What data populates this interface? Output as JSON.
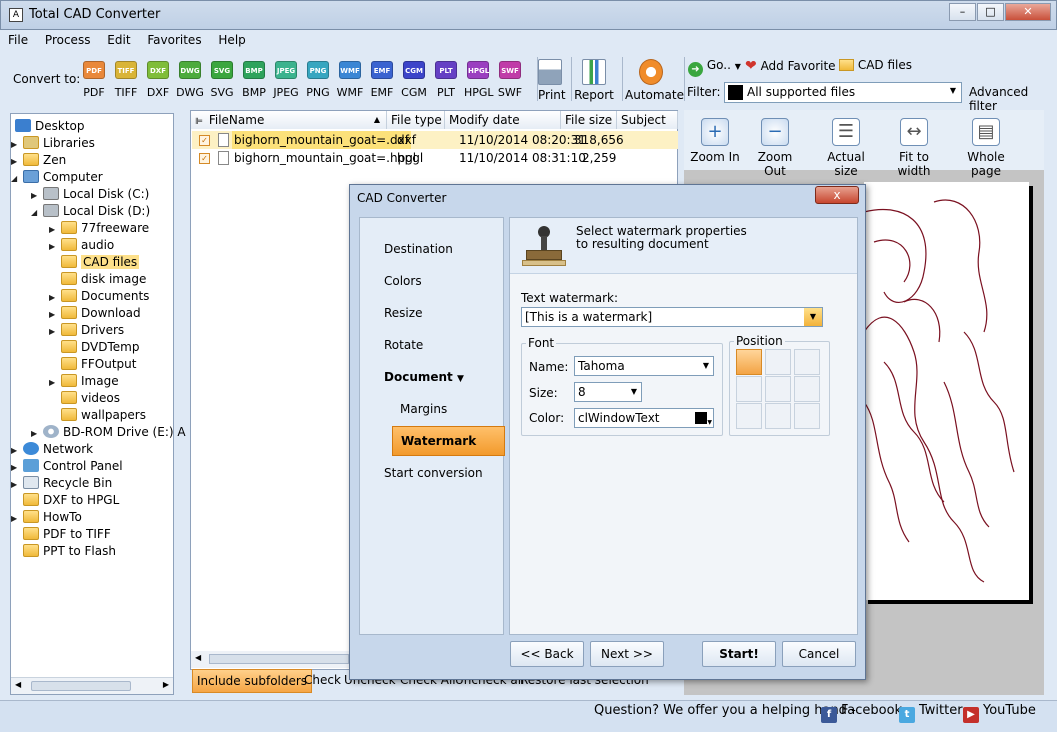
{
  "window": {
    "title": "Total CAD Converter"
  },
  "menu": [
    "File",
    "Process",
    "Edit",
    "Favorites",
    "Help"
  ],
  "toolbar": {
    "convert_to_label": "Convert to:",
    "formats": [
      {
        "label": "PDF",
        "color": "#e9883a"
      },
      {
        "label": "TIFF",
        "color": "#d9b437"
      },
      {
        "label": "DXF",
        "color": "#7fbd3a"
      },
      {
        "label": "DWG",
        "color": "#4cab3c"
      },
      {
        "label": "SVG",
        "color": "#3aa63f"
      },
      {
        "label": "BMP",
        "color": "#2ea35c"
      },
      {
        "label": "JPEG",
        "color": "#3bb38e"
      },
      {
        "label": "PNG",
        "color": "#37a6c0"
      },
      {
        "label": "WMF",
        "color": "#3a86d4"
      },
      {
        "label": "EMF",
        "color": "#3a63d0"
      },
      {
        "label": "CGM",
        "color": "#3c44c9"
      },
      {
        "label": "PLT",
        "color": "#6540c4"
      },
      {
        "label": "HPGL",
        "color": "#9a3fc0"
      },
      {
        "label": "SWF",
        "color": "#c03ca8"
      }
    ],
    "print": "Print",
    "report": "Report",
    "automate": "Automate",
    "go": "Go..",
    "add_favorite": "Add Favorite",
    "cad_files": "CAD files",
    "filter_label": "Filter:",
    "filter_value": "All supported files",
    "advanced_filter": "Advanced filter"
  },
  "tree": {
    "desktop": "Desktop",
    "libraries": "Libraries",
    "zen": "Zen",
    "computer": "Computer",
    "local_c": "Local Disk (C:)",
    "local_d": "Local Disk (D:)",
    "d_folders": [
      "77freeware",
      "audio",
      "CAD files",
      "disk image",
      "Documents",
      "Download",
      "Drivers",
      "DVDTemp",
      "FFOutput",
      "Image",
      "videos",
      "wallpapers"
    ],
    "bdrom": "BD-ROM Drive (E:) A",
    "network": "Network",
    "control_panel": "Control Panel",
    "recycle_bin": "Recycle Bin",
    "desk_folders": [
      "DXF to HPGL",
      "HowTo",
      "PDF to TIFF",
      "PPT to Flash"
    ]
  },
  "filelist": {
    "columns": [
      "FileName",
      "File type",
      "Modify date",
      "File size",
      "Subject"
    ],
    "rows": [
      {
        "name": "bighorn_mountain_goat=.dxf",
        "type": "dxf",
        "date": "11/10/2014 08:20:31",
        "size": "318,656"
      },
      {
        "name": "bighorn_mountain_goat=.hpgl",
        "type": "hpgl",
        "date": "11/10/2014 08:31:10",
        "size": "2,259"
      }
    ],
    "include_subfolders": "Include subfolders",
    "check": "Check",
    "uncheck": "Uncheck",
    "check_all": "Check All",
    "uncheck_all": "Uncheck all",
    "restore": "Restore last selection"
  },
  "preview": {
    "zoom_in": "Zoom In",
    "zoom_out": "Zoom Out",
    "actual_size": "Actual size",
    "fit_width": "Fit to width",
    "whole_page": "Whole page"
  },
  "status": {
    "question": "Question? We offer you a helping hand -",
    "facebook": "Facebook",
    "twitter": "Twitter",
    "youtube": "YouTube"
  },
  "dialog": {
    "title": "CAD Converter",
    "close": "x",
    "nav": {
      "destination": "Destination",
      "colors": "Colors",
      "resize": "Resize",
      "rotate": "Rotate",
      "document": "Document",
      "margins": "Margins",
      "watermark": "Watermark",
      "start": "Start conversion"
    },
    "header_line1": "Select watermark properties",
    "header_line2": "to resulting document",
    "text_watermark_label": "Text watermark:",
    "text_watermark_value": "[This is a watermark]",
    "font_legend": "Font",
    "name_label": "Name:",
    "name_value": "Tahoma",
    "size_label": "Size:",
    "size_value": "8",
    "color_label": "Color:",
    "color_value": "clWindowText",
    "position_legend": "Position",
    "back": "<< Back",
    "next": "Next >>",
    "start_btn": "Start!",
    "cancel": "Cancel"
  }
}
